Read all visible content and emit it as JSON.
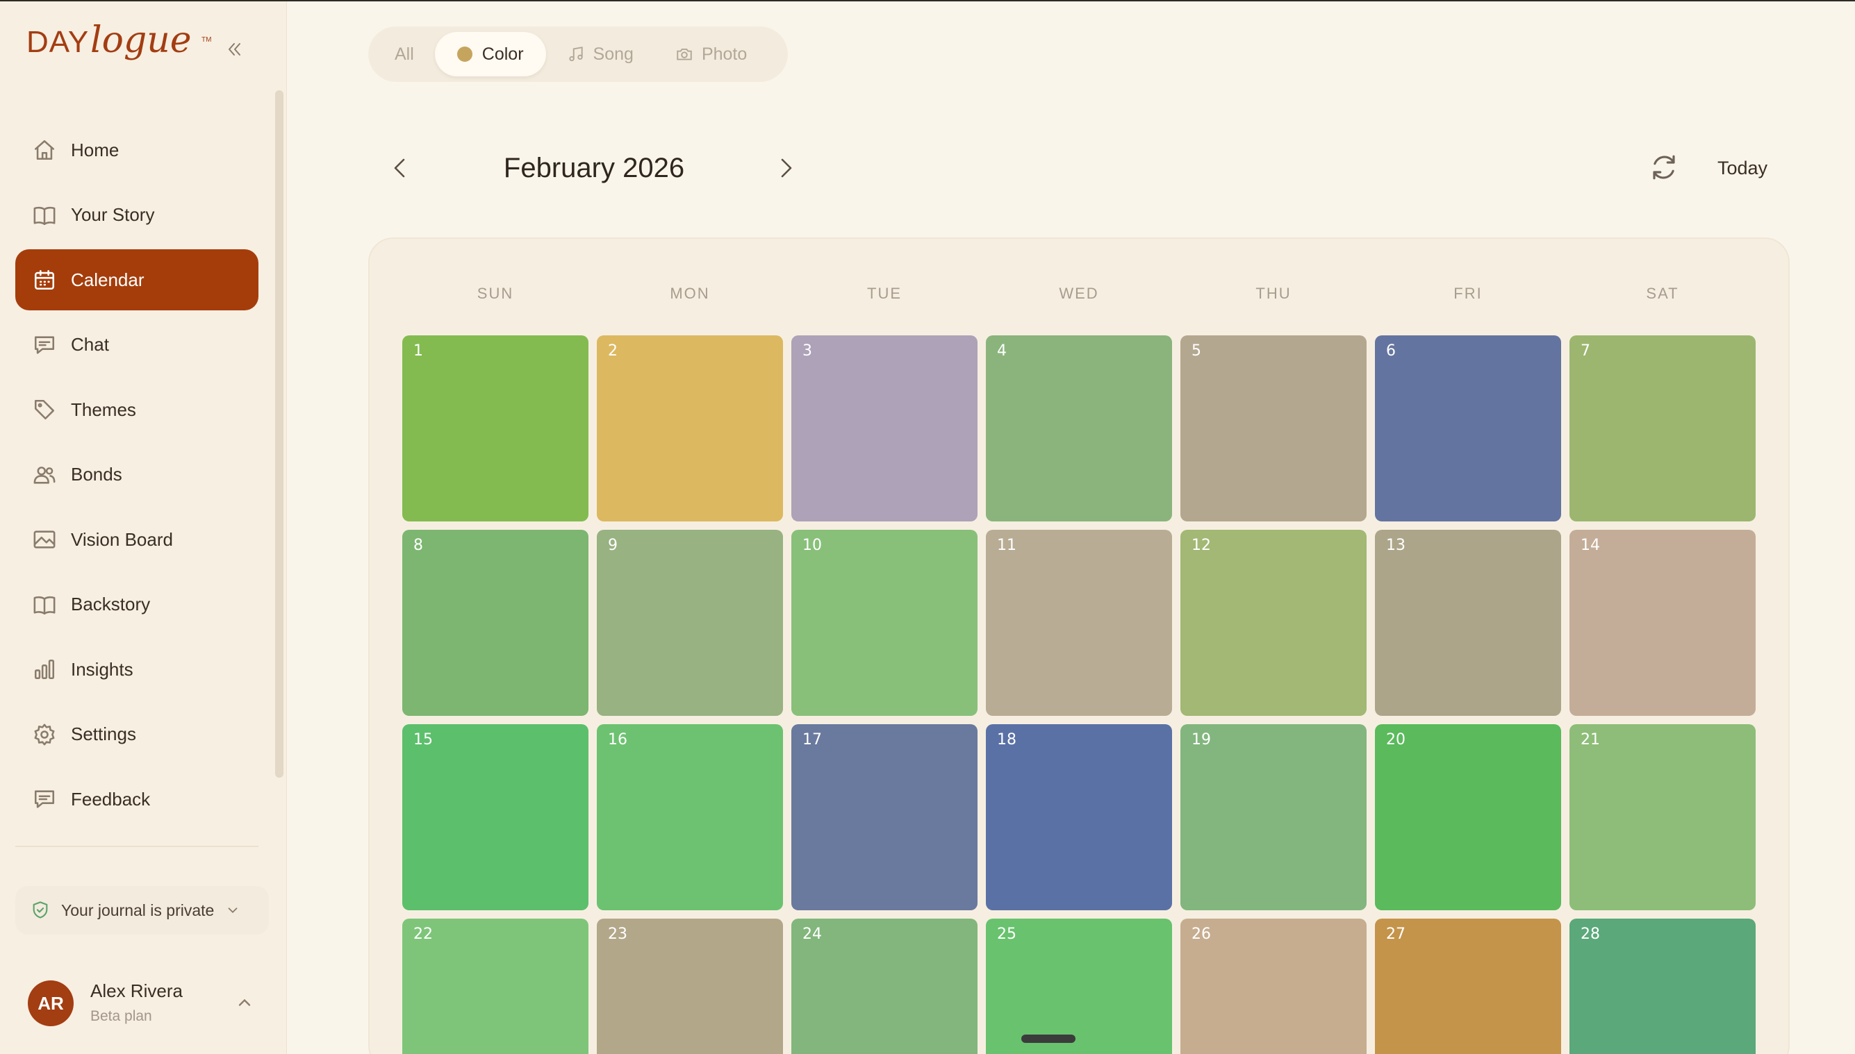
{
  "app": {
    "logo_day": "DAY",
    "logo_logue": "logue",
    "logo_tm": "TM"
  },
  "sidebar": {
    "items": [
      {
        "label": "Home",
        "icon": "home-icon",
        "active": false
      },
      {
        "label": "Your Story",
        "icon": "book-icon",
        "active": false
      },
      {
        "label": "Calendar",
        "icon": "calendar-icon",
        "active": true
      },
      {
        "label": "Chat",
        "icon": "chat-icon",
        "active": false
      },
      {
        "label": "Themes",
        "icon": "tag-icon",
        "active": false
      },
      {
        "label": "Bonds",
        "icon": "people-icon",
        "active": false
      },
      {
        "label": "Vision Board",
        "icon": "image-icon",
        "active": false
      },
      {
        "label": "Backstory",
        "icon": "book-icon",
        "active": false
      },
      {
        "label": "Insights",
        "icon": "bar-chart-icon",
        "active": false
      },
      {
        "label": "Settings",
        "icon": "gear-icon",
        "active": false
      },
      {
        "label": "Feedback",
        "icon": "message-icon",
        "active": false
      }
    ],
    "privacy_label": "Your journal is private",
    "user": {
      "initials": "AR",
      "name": "Alex Rivera",
      "plan": "Beta plan"
    }
  },
  "filters": {
    "items": [
      {
        "label": "All",
        "icon": "",
        "active": false
      },
      {
        "label": "Color",
        "icon": "color-dot-icon",
        "active": true
      },
      {
        "label": "Song",
        "icon": "music-note-icon",
        "active": false
      },
      {
        "label": "Photo",
        "icon": "camera-icon",
        "active": false
      }
    ]
  },
  "calendar": {
    "month_title": "February 2026",
    "today_label": "Today",
    "weekdays": [
      "SUN",
      "MON",
      "TUE",
      "WED",
      "THU",
      "FRI",
      "SAT"
    ],
    "days": [
      {
        "n": "1",
        "color": "#83bb50"
      },
      {
        "n": "2",
        "color": "#dcb860"
      },
      {
        "n": "3",
        "color": "#ada2b8"
      },
      {
        "n": "4",
        "color": "#8ab47c"
      },
      {
        "n": "5",
        "color": "#b4a78f"
      },
      {
        "n": "6",
        "color": "#6474a0"
      },
      {
        "n": "7",
        "color": "#9cb66f"
      },
      {
        "n": "8",
        "color": "#7cb670"
      },
      {
        "n": "9",
        "color": "#98b282"
      },
      {
        "n": "10",
        "color": "#88c07a"
      },
      {
        "n": "11",
        "color": "#b8ac94"
      },
      {
        "n": "12",
        "color": "#a2b874"
      },
      {
        "n": "13",
        "color": "#ada58a"
      },
      {
        "n": "14",
        "color": "#c4ad98"
      },
      {
        "n": "15",
        "color": "#5cbf6c"
      },
      {
        "n": "16",
        "color": "#6cc270"
      },
      {
        "n": "17",
        "color": "#6a799e"
      },
      {
        "n": "18",
        "color": "#5a71a6"
      },
      {
        "n": "19",
        "color": "#82b67e"
      },
      {
        "n": "20",
        "color": "#5aba5c"
      },
      {
        "n": "21",
        "color": "#8dbd78"
      },
      {
        "n": "22",
        "color": "#7ec57a"
      },
      {
        "n": "23",
        "color": "#b3a78a"
      },
      {
        "n": "24",
        "color": "#82b67c"
      },
      {
        "n": "25",
        "color": "#68c26e"
      },
      {
        "n": "26",
        "color": "#c6ad90"
      },
      {
        "n": "27",
        "color": "#c4944a"
      },
      {
        "n": "28",
        "color": "#5ba87a"
      }
    ]
  },
  "colors": {
    "accent": "#a53d0b",
    "background": "#faf5ea",
    "sidebar": "#f7efe2"
  }
}
